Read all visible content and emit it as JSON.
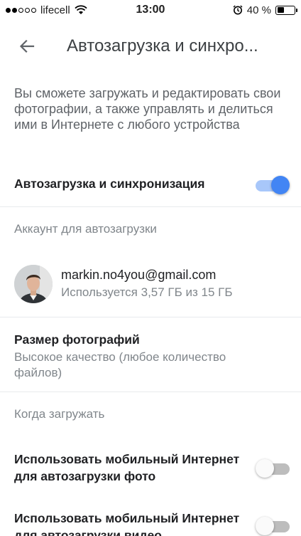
{
  "status_bar": {
    "carrier": "lifecell",
    "time": "13:00",
    "battery_percent": "40 %",
    "battery_level": 0.4,
    "signal_bars_filled": 2,
    "signal_bars_total": 5
  },
  "app_bar": {
    "title": "Автозагрузка и синхро..."
  },
  "description": "Вы сможете загружать и редактировать свои фотографии, а также управлять и делиться ими в Интернете с любого устройства",
  "sync_toggle": {
    "label": "Автозагрузка и синхронизация",
    "on": true
  },
  "account_section": {
    "header": "Аккаунт для автозагрузки",
    "email": "markin.no4you@gmail.com",
    "usage": "Используется 3,57 ГБ из 15 ГБ"
  },
  "photo_size": {
    "title": "Размер фотографий",
    "value": "Высокое качество (любое количество файлов)"
  },
  "when_section": {
    "header": "Когда загружать"
  },
  "mobile_photo": {
    "label_line1": "Использовать мобильный Интернет",
    "label_line2": "для автозагрузки фото",
    "on": false
  },
  "mobile_video": {
    "label_line1": "Использовать мобильный Интернет",
    "label_line2": "для автозагрузки видео",
    "on": false
  },
  "colors": {
    "toggle_on": "#4285f4",
    "toggle_on_track": "#a8c7fa",
    "toggle_off_track": "#bdbdbd"
  },
  "icons": {
    "back": "arrow-back-icon",
    "wifi": "wifi-icon",
    "alarm": "alarm-icon",
    "battery": "battery-icon"
  }
}
